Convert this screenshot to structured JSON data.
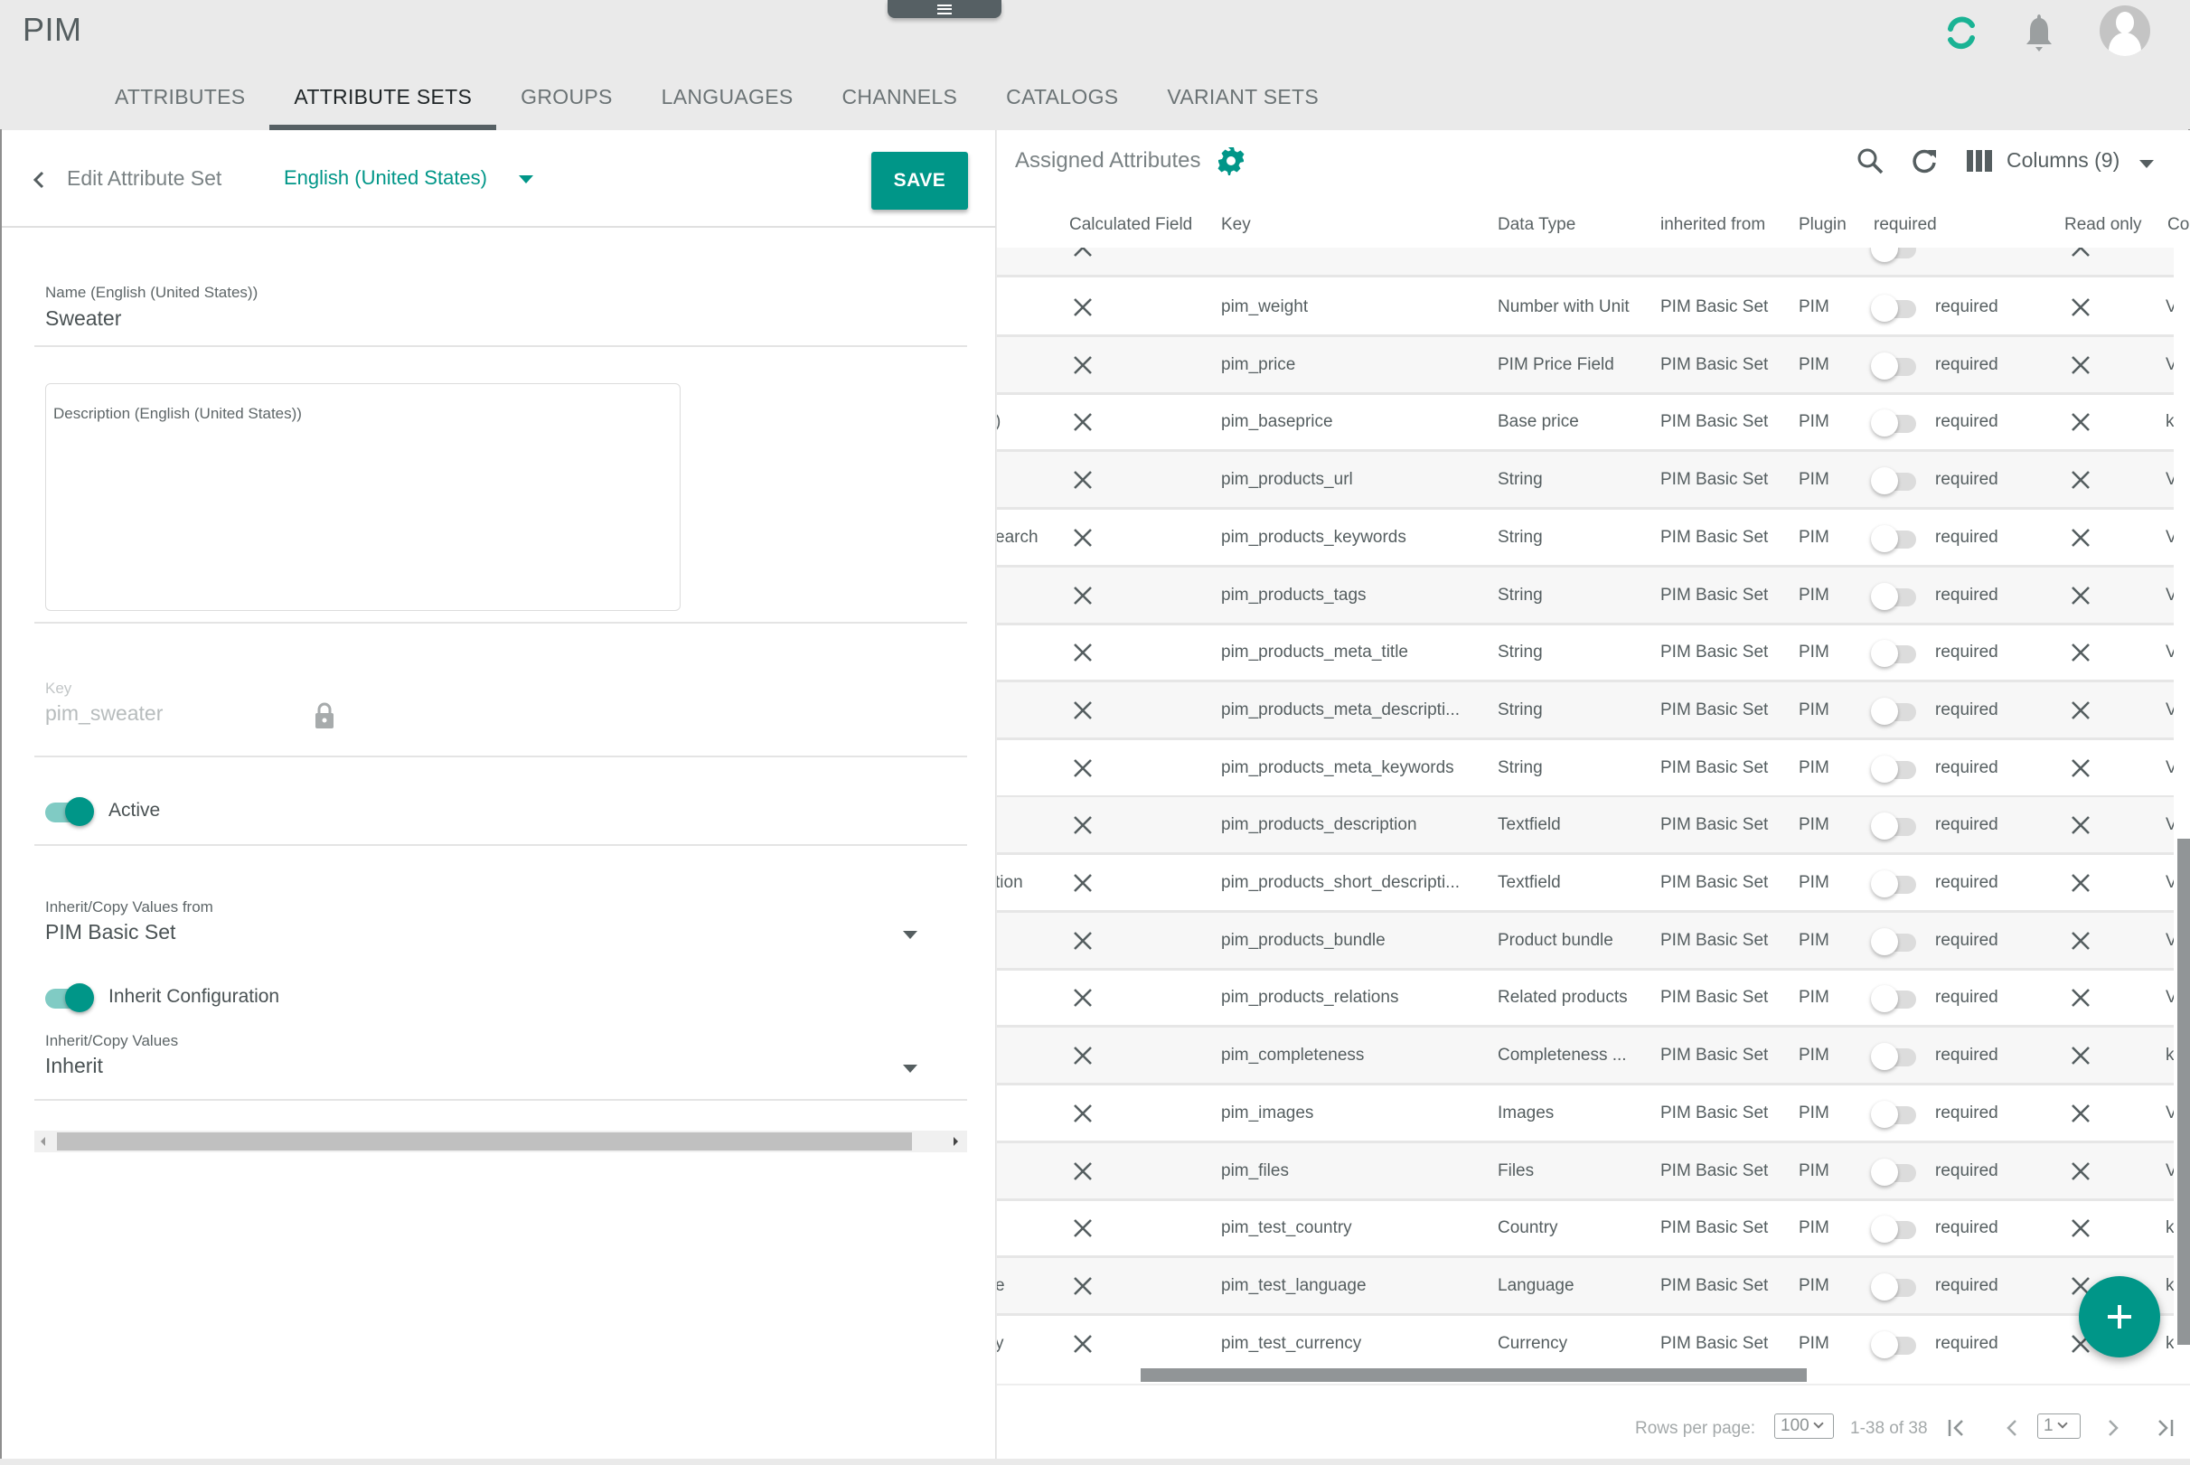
{
  "app": {
    "title": "PIM",
    "accent_color": "#009688",
    "header_icons": [
      "sync-icon",
      "bell-icon",
      "avatar-icon"
    ]
  },
  "tabs": [
    {
      "label": "ATTRIBUTES",
      "active": false
    },
    {
      "label": "ATTRIBUTE SETS",
      "active": true
    },
    {
      "label": "GROUPS",
      "active": false
    },
    {
      "label": "LANGUAGES",
      "active": false
    },
    {
      "label": "CHANNELS",
      "active": false
    },
    {
      "label": "CATALOGS",
      "active": false
    },
    {
      "label": "VARIANT SETS",
      "active": false
    }
  ],
  "edit": {
    "title": "Edit Attribute Set",
    "language": "English (United States)",
    "save_label": "SAVE",
    "name_label": "Name (English (United States))",
    "name_value": "Sweater",
    "description_label": "Description (English (United States))",
    "description_value": "",
    "key_label": "Key",
    "key_value": "pim_sweater",
    "active_label": "Active",
    "active_on": true,
    "inherit_from_label": "Inherit/Copy Values from",
    "inherit_from_value": "PIM Basic Set",
    "inherit_config_label": "Inherit Configuration",
    "inherit_config_on": true,
    "inherit_values_label": "Inherit/Copy Values",
    "inherit_values_value": "Inherit"
  },
  "assigned": {
    "title": "Assigned Attributes",
    "columns_label": "Columns (9)",
    "headers": {
      "calculated": "Calculated Field",
      "key": "Key",
      "data_type": "Data Type",
      "inherited_from": "inherited from",
      "plugin": "Plugin",
      "required": "required",
      "read_only": "Read only",
      "next": "Co"
    },
    "rows": [
      {
        "prefix": "",
        "key": "pim_weight",
        "type": "Number with Unit",
        "inherited": "PIM Basic Set",
        "plugin": "PIM",
        "required": "required",
        "tail": "V"
      },
      {
        "prefix": "",
        "key": "pim_price",
        "type": "PIM Price Field",
        "inherited": "PIM Basic Set",
        "plugin": "PIM",
        "required": "required",
        "tail": "V"
      },
      {
        "prefix": ")",
        "key": "pim_baseprice",
        "type": "Base price",
        "inherited": "PIM Basic Set",
        "plugin": "PIM",
        "required": "required",
        "tail": "k"
      },
      {
        "prefix": "",
        "key": "pim_products_url",
        "type": "String",
        "inherited": "PIM Basic Set",
        "plugin": "PIM",
        "required": "required",
        "tail": "V"
      },
      {
        "prefix": "earch",
        "key": "pim_products_keywords",
        "type": "String",
        "inherited": "PIM Basic Set",
        "plugin": "PIM",
        "required": "required",
        "tail": "V"
      },
      {
        "prefix": "",
        "key": "pim_products_tags",
        "type": "String",
        "inherited": "PIM Basic Set",
        "plugin": "PIM",
        "required": "required",
        "tail": "V"
      },
      {
        "prefix": "",
        "key": "pim_products_meta_title",
        "type": "String",
        "inherited": "PIM Basic Set",
        "plugin": "PIM",
        "required": "required",
        "tail": "V"
      },
      {
        "prefix": "",
        "key": "pim_products_meta_descripti...",
        "type": "String",
        "inherited": "PIM Basic Set",
        "plugin": "PIM",
        "required": "required",
        "tail": "V"
      },
      {
        "prefix": "",
        "key": "pim_products_meta_keywords",
        "type": "String",
        "inherited": "PIM Basic Set",
        "plugin": "PIM",
        "required": "required",
        "tail": "V"
      },
      {
        "prefix": "",
        "key": "pim_products_description",
        "type": "Textfield",
        "inherited": "PIM Basic Set",
        "plugin": "PIM",
        "required": "required",
        "tail": "V"
      },
      {
        "prefix": "tion",
        "key": "pim_products_short_descripti...",
        "type": "Textfield",
        "inherited": "PIM Basic Set",
        "plugin": "PIM",
        "required": "required",
        "tail": "V"
      },
      {
        "prefix": "",
        "key": "pim_products_bundle",
        "type": "Product bundle",
        "inherited": "PIM Basic Set",
        "plugin": "PIM",
        "required": "required",
        "tail": "V"
      },
      {
        "prefix": "",
        "key": "pim_products_relations",
        "type": "Related products",
        "inherited": "PIM Basic Set",
        "plugin": "PIM",
        "required": "required",
        "tail": "V"
      },
      {
        "prefix": "",
        "key": "pim_completeness",
        "type": "Completeness ...",
        "inherited": "PIM Basic Set",
        "plugin": "PIM",
        "required": "required",
        "tail": "k"
      },
      {
        "prefix": "",
        "key": "pim_images",
        "type": "Images",
        "inherited": "PIM Basic Set",
        "plugin": "PIM",
        "required": "required",
        "tail": "V"
      },
      {
        "prefix": "",
        "key": "pim_files",
        "type": "Files",
        "inherited": "PIM Basic Set",
        "plugin": "PIM",
        "required": "required",
        "tail": "V"
      },
      {
        "prefix": "",
        "key": "pim_test_country",
        "type": "Country",
        "inherited": "PIM Basic Set",
        "plugin": "PIM",
        "required": "required",
        "tail": "k"
      },
      {
        "prefix": "e",
        "key": "pim_test_language",
        "type": "Language",
        "inherited": "PIM Basic Set",
        "plugin": "PIM",
        "required": "required",
        "tail": "k"
      },
      {
        "prefix": "y",
        "key": "pim_test_currency",
        "type": "Currency",
        "inherited": "PIM Basic Set",
        "plugin": "PIM",
        "required": "required",
        "tail": "k"
      }
    ],
    "pager": {
      "rows_per_page_label": "Rows per page:",
      "rows_per_page": "100",
      "range": "1-38 of 38",
      "page": "1"
    }
  }
}
